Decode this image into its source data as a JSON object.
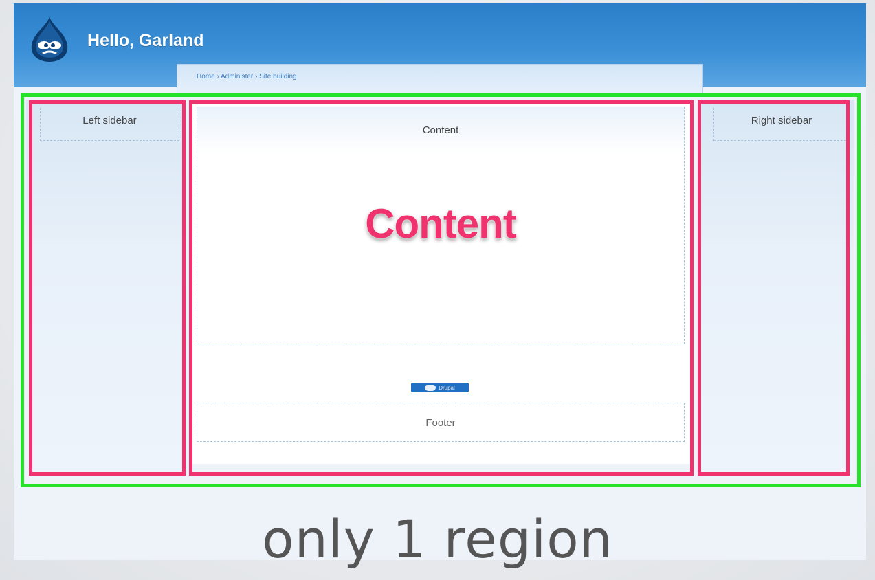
{
  "header": {
    "site_title": "Hello, Garland",
    "breadcrumb": "Home › Administer › Site building",
    "logo_icon": "drupal-drop-icon"
  },
  "regions": {
    "left_sidebar": "Left sidebar",
    "content": "Content",
    "right_sidebar": "Right sidebar",
    "footer": "Footer"
  },
  "annotation": {
    "big_label": "Content",
    "caption": "only 1 region"
  },
  "badge": {
    "label": "Drupal",
    "icon": "drupal-drop-icon"
  },
  "colors": {
    "header_blue": "#2b7fc9",
    "highlight_green": "#27e22a",
    "highlight_pink": "#f0336f"
  }
}
